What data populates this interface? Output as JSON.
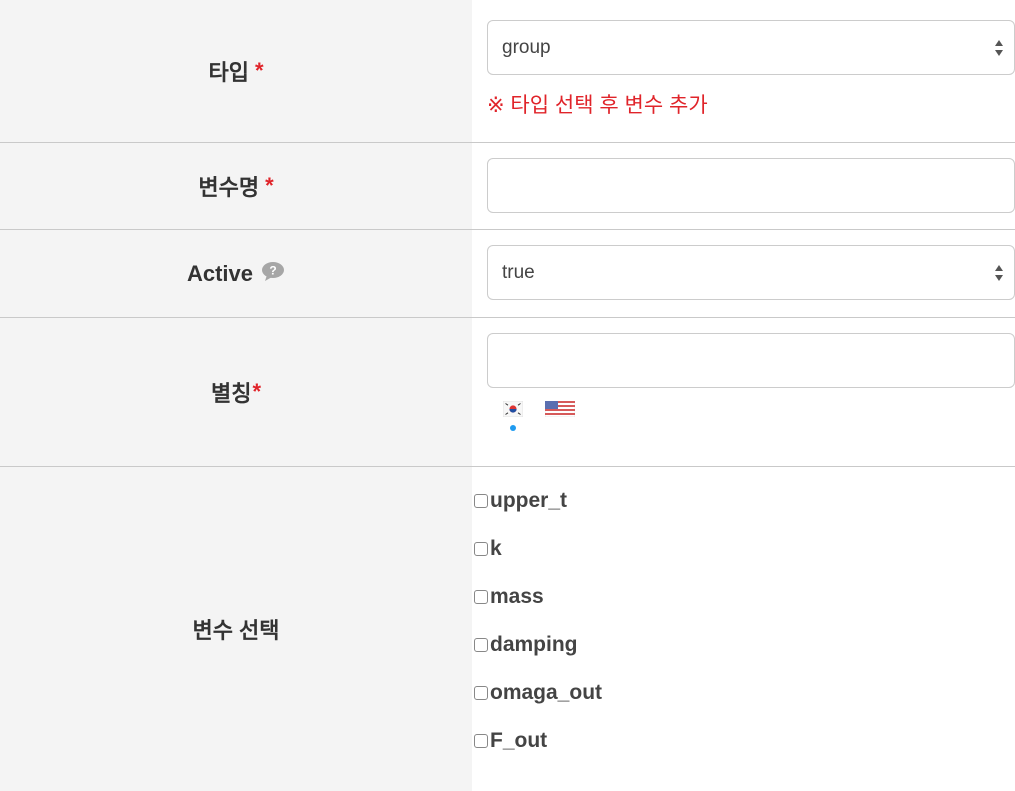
{
  "rows": {
    "type": {
      "label": "타입",
      "required_mark": "*",
      "select_value": "group",
      "note": "※ 타입 선택 후 변수 추가"
    },
    "var_name": {
      "label": "변수명",
      "required_mark": "*",
      "input_value": ""
    },
    "active": {
      "label": "Active",
      "help_icon": "question-bubble-icon",
      "select_value": "true"
    },
    "alias": {
      "label": "별칭",
      "required_mark": "*",
      "input_value": "",
      "languages": [
        "korean-flag-icon",
        "us-flag-icon"
      ],
      "active_language": "korean-flag-icon"
    },
    "var_select": {
      "label": "변수 선택",
      "options": [
        {
          "label": "upper_t",
          "checked": false
        },
        {
          "label": "k",
          "checked": false
        },
        {
          "label": "mass",
          "checked": false
        },
        {
          "label": "damping",
          "checked": false
        },
        {
          "label": "omaga_out",
          "checked": false
        },
        {
          "label": "F_out",
          "checked": false
        }
      ]
    }
  },
  "colors": {
    "required": "#e0242a",
    "label_bg": "#f4f4f4",
    "active_dot": "#1f9bf0"
  }
}
